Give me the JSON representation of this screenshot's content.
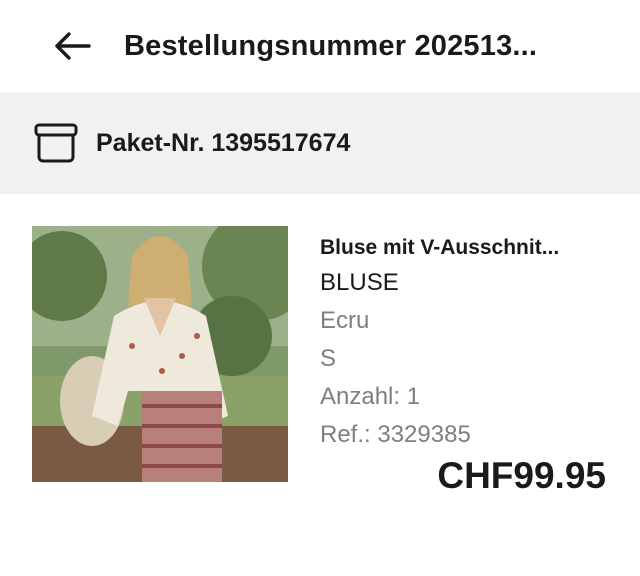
{
  "header": {
    "title": "Bestellungsnummer 202513..."
  },
  "package": {
    "label": "Paket-Nr. 1395517674"
  },
  "item": {
    "name": "Bluse mit V-Ausschnit...",
    "type": "BLUSE",
    "color": "Ecru",
    "size": "S",
    "quantity": "Anzahl: 1",
    "reference": "Ref.: 3329385",
    "price": "CHF99.95"
  },
  "icons": {
    "back": "arrow-left-icon",
    "package": "box-icon"
  }
}
